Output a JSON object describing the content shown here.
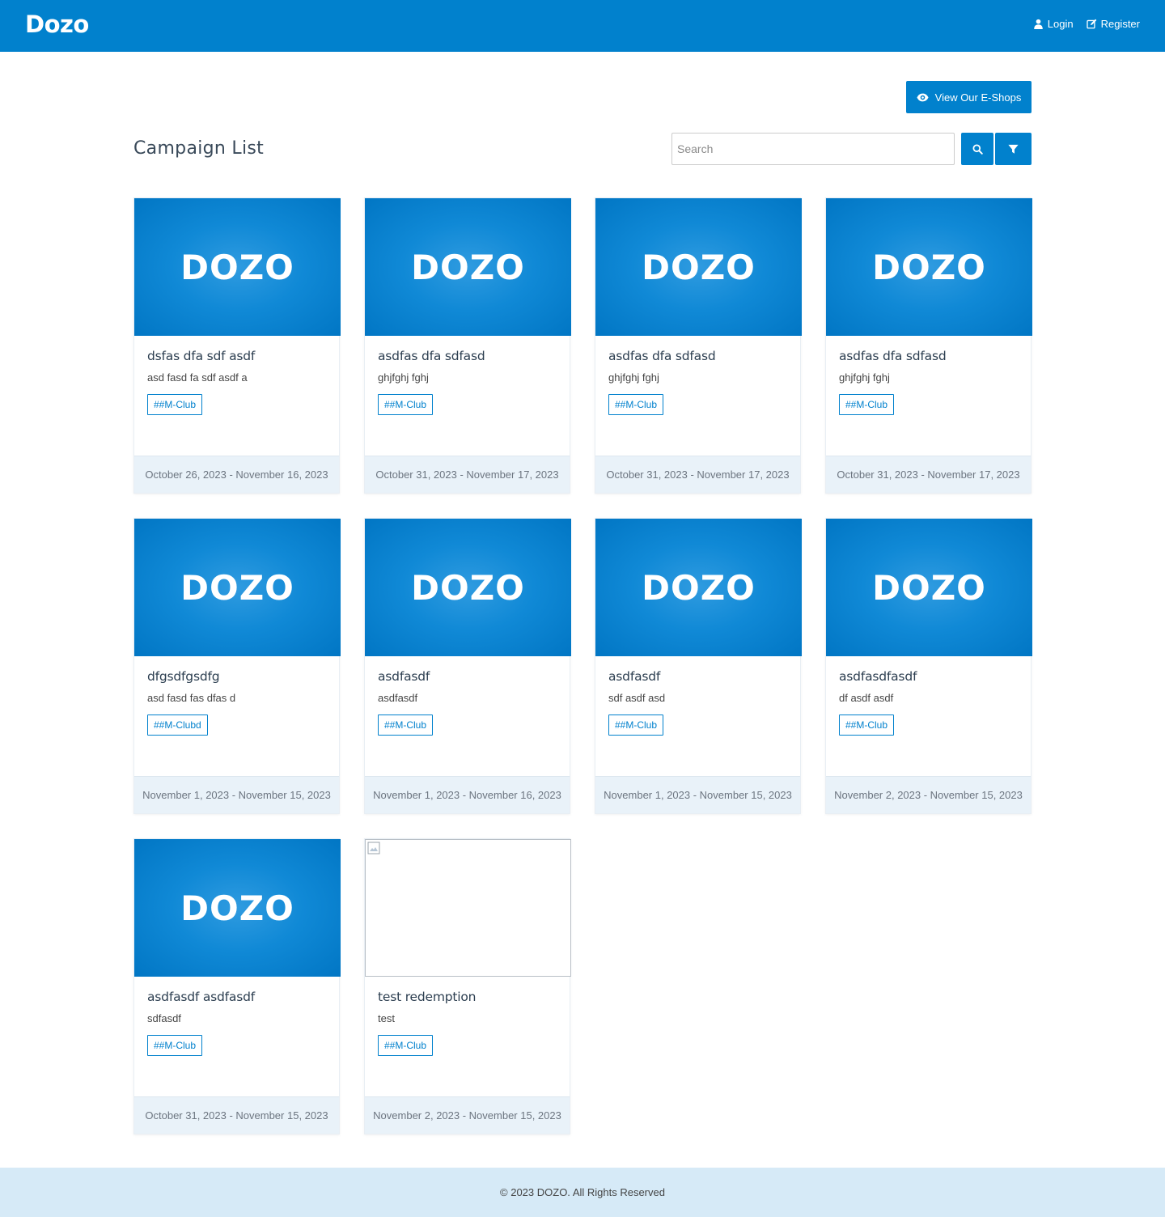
{
  "brand": "Dozo",
  "nav": {
    "login": "Login",
    "register": "Register"
  },
  "eshop_button": "View Our E-Shops",
  "page_title": "Campaign List",
  "search": {
    "placeholder": "Search",
    "value": ""
  },
  "logo_text": "DOZO",
  "campaigns": [
    {
      "title": "dsfas dfa sdf asdf",
      "desc": "asd fasd fa sdf asdf a",
      "tag": "##M-Club",
      "dates": "October 26, 2023 - November 16, 2023",
      "image": "dozo"
    },
    {
      "title": "asdfas dfa sdfasd",
      "desc": "ghjfghj fghj",
      "tag": "##M-Club",
      "dates": "October 31, 2023 - November 17, 2023",
      "image": "dozo"
    },
    {
      "title": "asdfas dfa sdfasd",
      "desc": "ghjfghj fghj",
      "tag": "##M-Club",
      "dates": "October 31, 2023 - November 17, 2023",
      "image": "dozo"
    },
    {
      "title": "asdfas dfa sdfasd",
      "desc": "ghjfghj fghj",
      "tag": "##M-Club",
      "dates": "October 31, 2023 - November 17, 2023",
      "image": "dozo"
    },
    {
      "title": "dfgsdfgsdfg",
      "desc": "asd fasd fas dfas d",
      "tag": "##M-Clubd",
      "dates": "November 1, 2023 - November 15, 2023",
      "image": "dozo"
    },
    {
      "title": "asdfasdf",
      "desc": "asdfasdf",
      "tag": "##M-Club",
      "dates": "November 1, 2023 - November 16, 2023",
      "image": "dozo"
    },
    {
      "title": "asdfasdf",
      "desc": "sdf asdf asd",
      "tag": "##M-Club",
      "dates": "November 1, 2023 - November 15, 2023",
      "image": "dozo"
    },
    {
      "title": "asdfasdfasdf",
      "desc": "df asdf asdf",
      "tag": "##M-Club",
      "dates": "November 2, 2023 - November 15, 2023",
      "image": "dozo"
    },
    {
      "title": "asdfasdf asdfasdf",
      "desc": "sdfasdf",
      "tag": "##M-Club",
      "dates": "October 31, 2023 - November 15, 2023",
      "image": "dozo"
    },
    {
      "title": "test redemption",
      "desc": "test",
      "tag": "##M-Club",
      "dates": "November 2, 2023 - November 15, 2023",
      "image": "broken"
    }
  ],
  "footer": "© 2023 DOZO. All Rights Reserved",
  "colors": {
    "primary": "#0181cd",
    "footer_bg": "#d6eaf7",
    "card_footer_bg": "#e9f2f9"
  }
}
